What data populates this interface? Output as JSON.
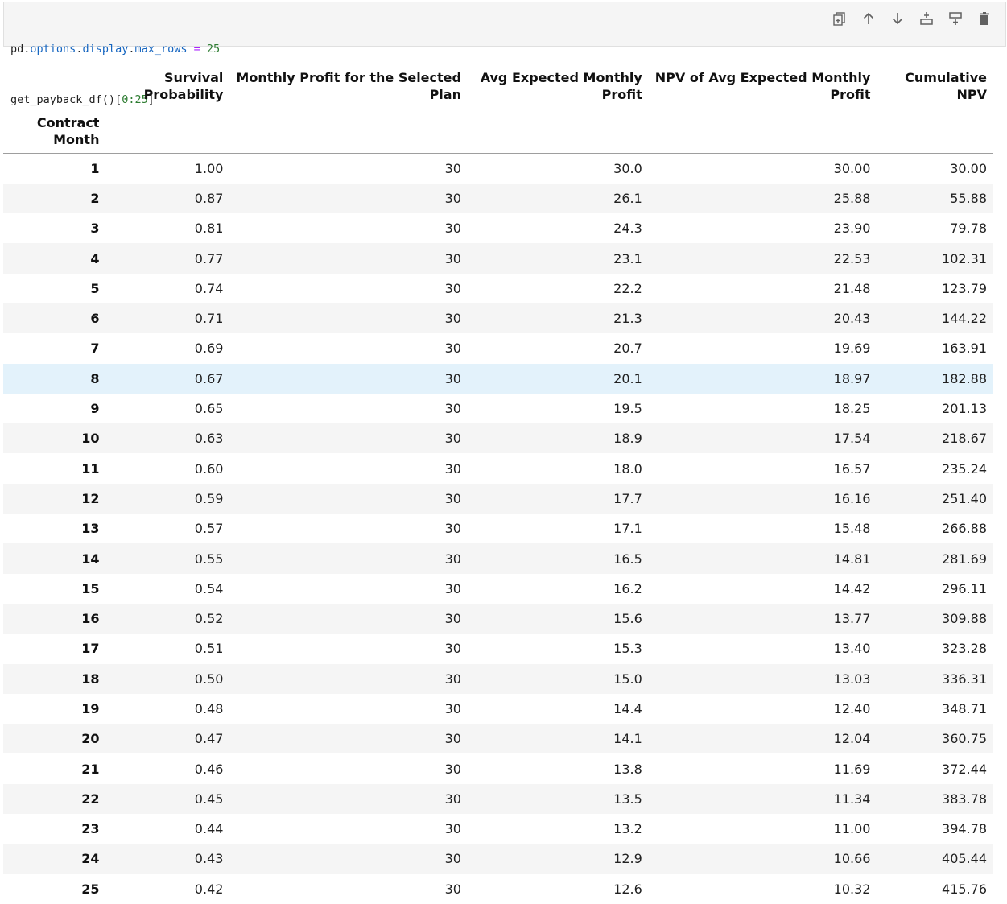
{
  "code": {
    "line1": {
      "module": "pd",
      "dot1": ".",
      "attr1": "options",
      "dot2": ".",
      "attr2": "display",
      "dot3": ".",
      "attr3": "max_rows",
      "eq": " = ",
      "num": "25"
    },
    "line2": {
      "func": "get_payback_df",
      "paren": "()",
      "lbr": "[",
      "slice": "0:25",
      "rbr": "]"
    }
  },
  "toolbar": {
    "icons": [
      "duplicate-icon",
      "move-up-icon",
      "move-down-icon",
      "insert-above-icon",
      "insert-below-icon",
      "delete-icon"
    ]
  },
  "table": {
    "index_name": [
      "Contract",
      "Month"
    ],
    "columns": [
      [
        "Survival",
        "Probability"
      ],
      [
        "Monthly Profit for the Selected",
        "Plan"
      ],
      [
        "Avg Expected Monthly",
        "Profit"
      ],
      [
        "NPV of Avg Expected Monthly",
        "Profit"
      ],
      [
        "Cumulative",
        "NPV"
      ]
    ],
    "rows": [
      [
        "1",
        "1.00",
        "30",
        "30.0",
        "30.00",
        "30.00"
      ],
      [
        "2",
        "0.87",
        "30",
        "26.1",
        "25.88",
        "55.88"
      ],
      [
        "3",
        "0.81",
        "30",
        "24.3",
        "23.90",
        "79.78"
      ],
      [
        "4",
        "0.77",
        "30",
        "23.1",
        "22.53",
        "102.31"
      ],
      [
        "5",
        "0.74",
        "30",
        "22.2",
        "21.48",
        "123.79"
      ],
      [
        "6",
        "0.71",
        "30",
        "21.3",
        "20.43",
        "144.22"
      ],
      [
        "7",
        "0.69",
        "30",
        "20.7",
        "19.69",
        "163.91"
      ],
      [
        "8",
        "0.67",
        "30",
        "20.1",
        "18.97",
        "182.88"
      ],
      [
        "9",
        "0.65",
        "30",
        "19.5",
        "18.25",
        "201.13"
      ],
      [
        "10",
        "0.63",
        "30",
        "18.9",
        "17.54",
        "218.67"
      ],
      [
        "11",
        "0.60",
        "30",
        "18.0",
        "16.57",
        "235.24"
      ],
      [
        "12",
        "0.59",
        "30",
        "17.7",
        "16.16",
        "251.40"
      ],
      [
        "13",
        "0.57",
        "30",
        "17.1",
        "15.48",
        "266.88"
      ],
      [
        "14",
        "0.55",
        "30",
        "16.5",
        "14.81",
        "281.69"
      ],
      [
        "15",
        "0.54",
        "30",
        "16.2",
        "14.42",
        "296.11"
      ],
      [
        "16",
        "0.52",
        "30",
        "15.6",
        "13.77",
        "309.88"
      ],
      [
        "17",
        "0.51",
        "30",
        "15.3",
        "13.40",
        "323.28"
      ],
      [
        "18",
        "0.50",
        "30",
        "15.0",
        "13.03",
        "336.31"
      ],
      [
        "19",
        "0.48",
        "30",
        "14.4",
        "12.40",
        "348.71"
      ],
      [
        "20",
        "0.47",
        "30",
        "14.1",
        "12.04",
        "360.75"
      ],
      [
        "21",
        "0.46",
        "30",
        "13.8",
        "11.69",
        "372.44"
      ],
      [
        "22",
        "0.45",
        "30",
        "13.5",
        "11.34",
        "383.78"
      ],
      [
        "23",
        "0.44",
        "30",
        "13.2",
        "11.00",
        "394.78"
      ],
      [
        "24",
        "0.43",
        "30",
        "12.9",
        "10.66",
        "405.44"
      ],
      [
        "25",
        "0.42",
        "30",
        "12.6",
        "10.32",
        "415.76"
      ]
    ],
    "hovered_row_index": 7
  },
  "colors": {
    "hover_row": "#e3f2fb",
    "stripe": "#f5f5f5",
    "code_bg": "#f5f5f5"
  }
}
